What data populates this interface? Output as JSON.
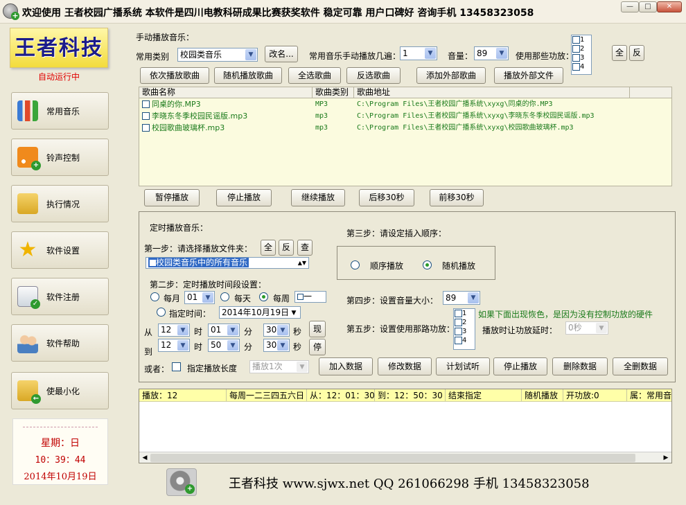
{
  "window": {
    "title": "欢迎使用 王者校园广播系统 本软件是四川电教科研成果比赛获奖软件 稳定可靠 用户口碑好 咨询手机 13458323058",
    "min": "—",
    "max": "□",
    "close": "✕"
  },
  "sidebar": {
    "logo_text": "王者科技",
    "status": "自动运行中",
    "items": [
      {
        "label": "常用音乐",
        "icon": "music-chart-icon"
      },
      {
        "label": "铃声控制",
        "icon": "rss-bell-icon"
      },
      {
        "label": "执行情况",
        "icon": "folder-gear-icon"
      },
      {
        "label": "软件设置",
        "icon": "star-icon"
      },
      {
        "label": "软件注册",
        "icon": "register-check-icon"
      },
      {
        "label": "软件帮助",
        "icon": "people-help-icon"
      },
      {
        "label": "使最小化",
        "icon": "minimize-folder-icon"
      }
    ],
    "calendar": {
      "weekday": "星期：日",
      "time": "10：39：44",
      "date": "2014年10月19日"
    }
  },
  "manual": {
    "section_label": "手动播放音乐：",
    "category_label": "常用类别",
    "category_value": "校园类音乐",
    "rename_button": "改名...",
    "repeat_label": "常用音乐手动播放几遍：",
    "repeat_value": "1",
    "volume_label": "音量：",
    "volume_value": "89",
    "function_label": "使用那些功放：",
    "function_options": [
      "1",
      "2",
      "3",
      "4"
    ],
    "all_button": "全",
    "invert_button": "反",
    "buttons": [
      "依次播放歌曲",
      "随机播放歌曲",
      "全选歌曲",
      "反选歌曲",
      "添加外部歌曲",
      "播放外部文件"
    ]
  },
  "song_table": {
    "columns": [
      "歌曲名称",
      "歌曲类别",
      "歌曲地址"
    ],
    "rows": [
      {
        "name": "同桌的你.MP3",
        "category": "MP3",
        "path": "C:\\Program Files\\王者校园广播系统\\xyxg\\同桌的你.MP3"
      },
      {
        "name": "李晓东冬季校园民谣版.mp3",
        "category": "mp3",
        "path": "C:\\Program Files\\王者校园广播系统\\xyxg\\李晓东冬季校园民谣版.mp3"
      },
      {
        "name": "校园歌曲玻璃杯.mp3",
        "category": "mp3",
        "path": "C:\\Program Files\\王者校园广播系统\\xyxg\\校园歌曲玻璃杯.mp3"
      }
    ]
  },
  "playback_buttons": [
    "暂停播放",
    "停止播放",
    "继续播放",
    "后移30秒",
    "前移30秒"
  ],
  "schedule": {
    "section_label": "定时播放音乐：",
    "step1_label": "第一步：请选择播放文件夹：",
    "step1_buttons": [
      "全",
      "反",
      "查"
    ],
    "folder_value": "校园类音乐中的所有音乐",
    "step2_label": "第二步：定时播放时间段设置：",
    "monthly_label": "每月",
    "monthly_value": "01",
    "daily_label": "每天",
    "weekly_label": "每周",
    "weekly_value": "一",
    "specific_label": "指定时间：",
    "specific_date": "2014年10月19日",
    "from_label": "从",
    "to_label": "到",
    "from_h": "12",
    "from_m": "01",
    "from_s": "30",
    "to_h": "12",
    "to_m": "50",
    "to_s": "30",
    "h_label": "时",
    "m_label": "分",
    "s_label": "秒",
    "now_button": "现",
    "stop_button": "停",
    "or_label": "或者：",
    "duration_label": "指定播放长度",
    "duration_value": "播放1次",
    "step3_label": "第三步：请设定插入顺序：",
    "order_sequential": "顺序播放",
    "order_random": "随机播放",
    "step4_label": "第四步：设置音量大小：",
    "step4_volume": "89",
    "hint": "如果下面出现恢色，是因为没有控制功放的硬件",
    "step5_label": "第五步：设置使用那路功放：",
    "step5_options": [
      "1",
      "2",
      "3",
      "4"
    ],
    "delay_label": "播放时让功放延时：",
    "delay_value": "0秒",
    "action_buttons": [
      "加入数据",
      "修改数据",
      "计划试听",
      "停止播放",
      "删除数据",
      "全删数据"
    ]
  },
  "bottom_table": {
    "columns": [
      "播放：12",
      "每周一二三四五六日",
      "从：12：01：30",
      "到：12：50：30",
      "结束指定",
      "随机播放",
      "开功放:0",
      "属：常用音"
    ]
  },
  "footer": {
    "text": "王者科技  www.sjwx.net QQ 261066298 手机 13458323058"
  }
}
